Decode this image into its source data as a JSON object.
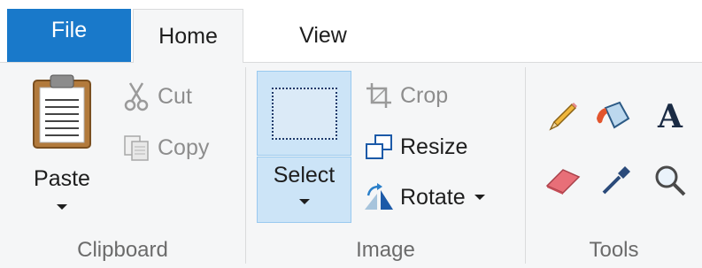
{
  "tabs": [
    {
      "label": "File",
      "active": false,
      "accent": "#1979ca"
    },
    {
      "label": "Home",
      "active": true
    },
    {
      "label": "View",
      "active": false
    }
  ],
  "clipboard": {
    "label": "Clipboard",
    "paste_label": "Paste",
    "cut_label": "Cut",
    "copy_label": "Copy",
    "paste_icon": "clipboard-icon",
    "cut_icon": "scissors-icon",
    "copy_icon": "copy-icon"
  },
  "image": {
    "label": "Image",
    "select_label": "Select",
    "crop_label": "Crop",
    "resize_label": "Resize",
    "rotate_label": "Rotate",
    "select_icon": "selection-rectangle-icon",
    "crop_icon": "crop-icon",
    "resize_icon": "resize-icon",
    "rotate_icon": "rotate-icon"
  },
  "tools": {
    "label": "Tools",
    "items": [
      "pencil-icon",
      "fill-bucket-icon",
      "text-icon",
      "eraser-icon",
      "color-picker-icon",
      "magnifier-icon"
    ]
  },
  "colors": {
    "accent": "#1979ca",
    "select_bg": "#cce4f7",
    "select_border": "#99c9ef"
  }
}
